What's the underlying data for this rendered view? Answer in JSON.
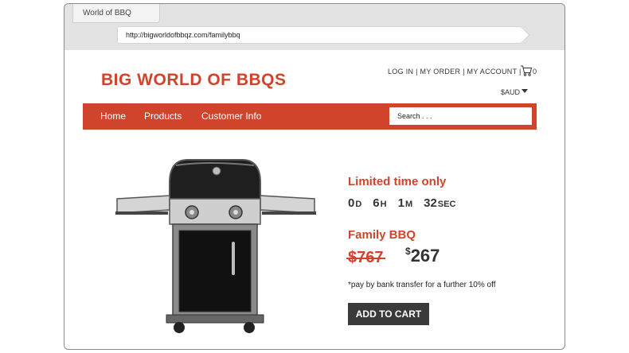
{
  "browser": {
    "tab_title": "World of BBQ",
    "url": "http://bigworldofbbqz.com/familybbq"
  },
  "header": {
    "logo": "BIG WORLD OF BBQS",
    "links": "LOG IN | MY ORDER | MY ACCOUNT |",
    "cart_count": "0",
    "currency": "$AUD"
  },
  "nav": {
    "items": [
      "Home",
      "Products",
      "Customer Info"
    ],
    "search_placeholder": "Search . . ."
  },
  "product": {
    "image": "bbq-grill",
    "promo": "Limited time only",
    "countdown": {
      "days": "0",
      "days_label": "D",
      "hours": "6",
      "hours_label": "H",
      "minutes": "1",
      "minutes_label": "M",
      "seconds": "32",
      "seconds_label": "SEC"
    },
    "name": "Family BBQ",
    "old_price": "$767",
    "currency_symbol": "$",
    "new_price": "267",
    "note": "*pay by bank transfer for a further 10% off",
    "add_to_cart": "ADD TO CART"
  },
  "colors": {
    "accent": "#d0442c",
    "button": "#3a3a3a"
  }
}
